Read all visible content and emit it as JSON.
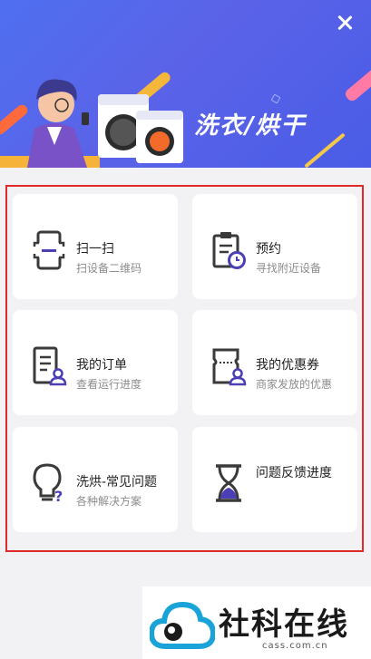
{
  "header": {
    "title": "洗衣/烘干",
    "close_icon": "close-icon"
  },
  "cards": [
    {
      "title": "扫一扫",
      "subtitle": "扫设备二维码",
      "icon": "scan-phone-icon"
    },
    {
      "title": "预约",
      "subtitle": "寻找附近设备",
      "icon": "clipboard-clock-icon"
    },
    {
      "title": "我的订单",
      "subtitle": "查看运行进度",
      "icon": "order-user-icon"
    },
    {
      "title": "我的优惠券",
      "subtitle": "商家发放的优惠",
      "icon": "coupon-user-icon"
    },
    {
      "title": "洗烘-常见问题",
      "subtitle": "各种解决方案",
      "icon": "lightbulb-question-icon"
    },
    {
      "title": "问题反馈进度",
      "subtitle": "",
      "icon": "hourglass-icon"
    }
  ],
  "watermark": {
    "text": "社科在线",
    "url": "cass.com.cn"
  },
  "colors": {
    "header_bg": "#4f6ff0",
    "accent_purple": "#4b3fb5",
    "icon_dark": "#3a3a3a",
    "highlight_border": "#e02a2a"
  }
}
